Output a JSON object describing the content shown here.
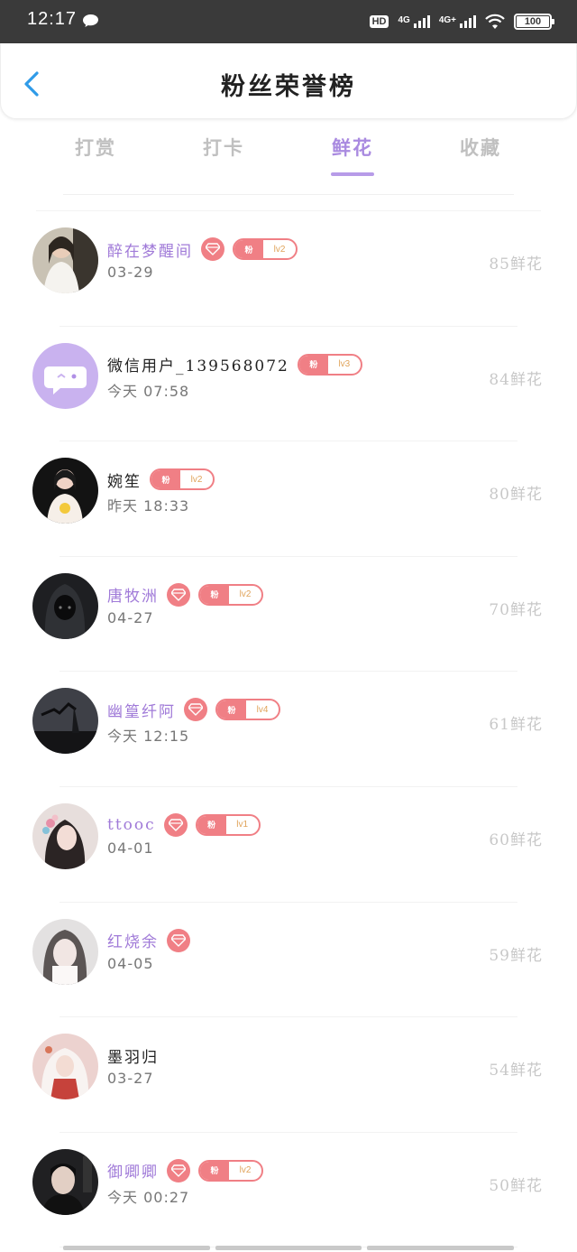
{
  "status_bar": {
    "time": "12:17",
    "hd_label": "HD",
    "net1_label": "4G",
    "net2_label": "4G+",
    "battery": "100"
  },
  "header": {
    "title": "粉丝荣誉榜"
  },
  "tabs": [
    {
      "label": "打赏",
      "active": false
    },
    {
      "label": "打卡",
      "active": false
    },
    {
      "label": "鲜花",
      "active": true
    },
    {
      "label": "收藏",
      "active": false
    }
  ],
  "fan_badge_label": "粉",
  "rows": [
    {
      "name": "醉在梦醒间",
      "date": "03-29",
      "count": "85鲜花",
      "vip": true,
      "diamond": true,
      "level": "lv2",
      "avatar": "woman-white-dress"
    },
    {
      "name": "微信用户_139568072",
      "date": "今天  07:58",
      "count": "84鲜花",
      "vip": false,
      "diamond": false,
      "level": "lv3",
      "avatar": "default-chat-avatar"
    },
    {
      "name": "婉笙",
      "date": "昨天  18:33",
      "count": "80鲜花",
      "vip": false,
      "diamond": false,
      "level": "lv2",
      "avatar": "girl-yellow-shirt"
    },
    {
      "name": "唐牧洲",
      "date": "04-27",
      "count": "70鲜花",
      "vip": true,
      "diamond": true,
      "level": "lv2",
      "avatar": "dark-hooded-figure"
    },
    {
      "name": "幽篁纤阿",
      "date": "今天  12:15",
      "count": "61鲜花",
      "vip": true,
      "diamond": true,
      "level": "lv4",
      "avatar": "night-sky-bird"
    },
    {
      "name": "ttooc",
      "date": "04-01",
      "count": "60鲜花",
      "vip": true,
      "diamond": true,
      "level": "lv1",
      "avatar": "anime-flower-girl"
    },
    {
      "name": "红烧余",
      "date": "04-05",
      "count": "59鲜花",
      "vip": true,
      "diamond": true,
      "level": "",
      "avatar": "woman-pale"
    },
    {
      "name": "墨羽归",
      "date": "03-27",
      "count": "54鲜花",
      "vip": false,
      "diamond": false,
      "level": "",
      "avatar": "anime-white-hair"
    },
    {
      "name": "御卿卿",
      "date": "今天  00:27",
      "count": "50鲜花",
      "vip": true,
      "diamond": true,
      "level": "lv2",
      "avatar": "man-dark"
    }
  ]
}
